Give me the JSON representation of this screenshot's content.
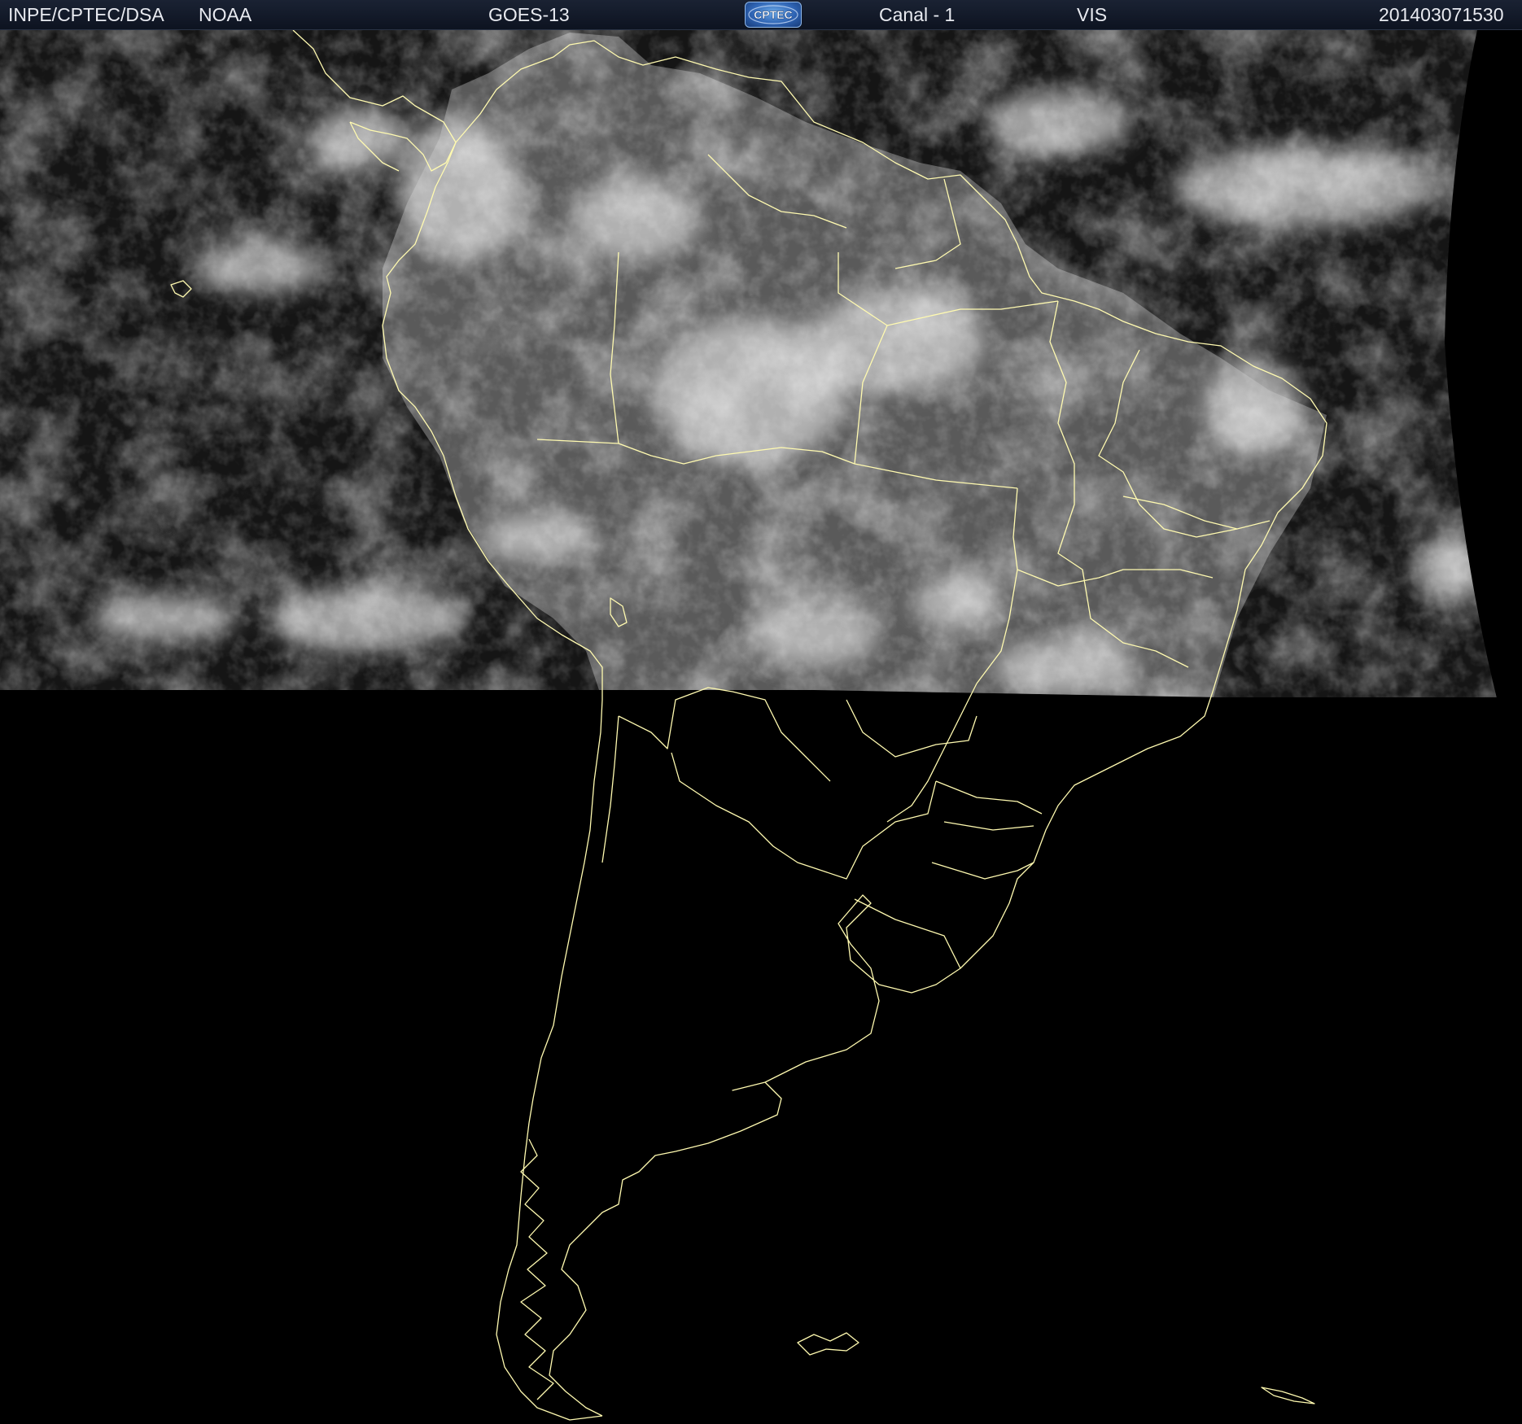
{
  "header": {
    "agency": "INPE/CPTEC/DSA",
    "source": "NOAA",
    "satellite": "GOES-13",
    "logo_text": "CPTEC",
    "channel": "Canal - 1",
    "band": "VIS",
    "timestamp": "201403071530"
  },
  "image": {
    "kind": "visible-channel satellite imagery (grayscale)",
    "coastline_color": "#fffab0",
    "night_side_color": "#000000",
    "cloud_color": "#d8d8d8",
    "land_color": "#6a6a6a",
    "ocean_color": "#202020"
  }
}
